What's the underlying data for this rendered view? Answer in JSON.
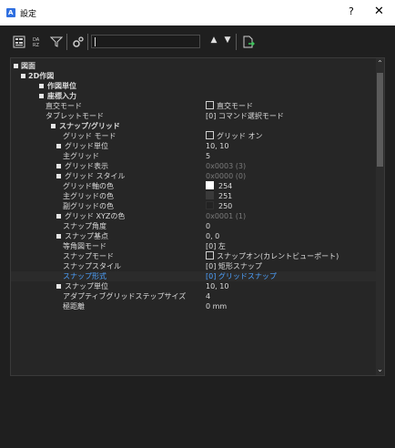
{
  "window": {
    "title": "設定",
    "app_icon_letter": "A",
    "help": "?",
    "close": "✕"
  },
  "toolbar": {
    "search_value": "",
    "icons": [
      "categorized-view-icon",
      "alphabetical-view-icon",
      "filter-icon",
      "settings-icon",
      "arrow-up-icon",
      "arrow-down-icon",
      "export-icon"
    ],
    "up": "▲",
    "down": "▼"
  },
  "colors": {
    "accent_blue": "#4ea2ff",
    "swatch_254": "#fefefe",
    "swatch_251": "#3a3a3a",
    "swatch_250": "#232323"
  },
  "tree": {
    "drawing": "図面",
    "d2": "2D作図",
    "units": "作図単位",
    "coord": "座標入力",
    "ortho_label": "直交モード",
    "ortho_value": "直交モード",
    "tablet_label": "タブレットモード",
    "tablet_value": "[0] コマンド選択モード",
    "snap_grid": "スナップ/グリッド",
    "grid_mode_label": "グリッド モード",
    "grid_mode_value": "グリッド オン",
    "grid_unit_label": "グリッド単位",
    "grid_unit_value": "10, 10",
    "main_grid_label": "主グリッド",
    "main_grid_value": "5",
    "grid_display_label": "グリッド表示",
    "grid_display_value": "0x0003 (3)",
    "grid_style_label": "グリッド スタイル",
    "grid_style_value": "0x0000 (0)",
    "grid_axis_color_label": "グリッド軸の色",
    "grid_axis_color_value": "254",
    "main_grid_color_label": "主グリッドの色",
    "main_grid_color_value": "251",
    "sub_grid_color_label": "副グリッドの色",
    "sub_grid_color_value": "250",
    "grid_xyz_label": "グリッド XYZの色",
    "grid_xyz_value": "0x0001 (1)",
    "snap_angle_label": "スナップ角度",
    "snap_angle_value": "0",
    "snap_base_label": "スナップ基点",
    "snap_base_value": "0, 0",
    "iso_mode_label": "等角図モード",
    "iso_mode_value": "[0] 左",
    "snap_mode_label": "スナップモード",
    "snap_mode_value": "スナップオン(カレントビューポート)",
    "snap_style_label": "スナップスタイル",
    "snap_style_value": "[0] 矩形スナップ",
    "snap_type_label": "スナップ形式",
    "snap_type_value": "[0] グリッドスナップ",
    "snap_unit_label": "スナップ単位",
    "snap_unit_value": "10, 10",
    "adaptive_label": "アダプティブグリッドステップサイズ",
    "adaptive_value": "4",
    "polar_label": "極距離",
    "polar_value": "0 mm"
  }
}
